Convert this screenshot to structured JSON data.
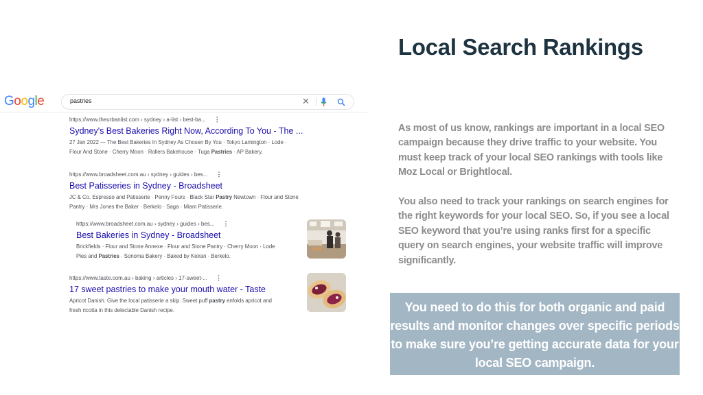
{
  "title": "Local Search Rankings",
  "serp": {
    "logo": {
      "letters": [
        {
          "char": "G",
          "color": "#4285F4"
        },
        {
          "char": "o",
          "color": "#EA4335"
        },
        {
          "char": "o",
          "color": "#FBBC05"
        },
        {
          "char": "g",
          "color": "#4285F4"
        },
        {
          "char": "l",
          "color": "#34A853"
        },
        {
          "char": "e",
          "color": "#EA4335"
        }
      ]
    },
    "query": "pastries",
    "clear_icon": "close-icon",
    "mic_icon": "mic-icon",
    "search_icon": "search-icon",
    "results": [
      {
        "url": "https://www.theurbanlist.com › sydney › a-list › best-ba...",
        "title": "Sydney's Best Bakeries Right Now, According To You - The ...",
        "snippet_line1": "27 Jan 2022 — The Best Bakeries In Sydney As Chosen By You · Tokyo Lamington · Lode ·",
        "snippet_line2_pre": "Flour And Stone · Cherry Moon · Rollers Bakehouse · Tuga ",
        "snippet_line2_bold": "Pastries",
        "snippet_line2_post": " · AP Bakery."
      },
      {
        "url": "https://www.broadsheet.com.au › sydney › guides › bes...",
        "title": "Best Patisseries in Sydney - Broadsheet",
        "snippet_line1_pre": "JC & Co. Espresso and Patisserie · Penny Fours · Black Star ",
        "snippet_line1_bold": "Pastry",
        "snippet_line1_post": " Newtown · Flour and Stone",
        "snippet_line2": "Pantry · Mrs Jones the Baker · Berkelo · Saga · Miam Patisserie."
      },
      {
        "url": "https://www.broadsheet.com.au › sydney › guides › bes...",
        "title": "Best Bakeries in Sydney - Broadsheet",
        "snippet_line1": "Brickfields · Flour and Stone Annexe · Flour and Stone Pantry · Cherry Moon · Lode",
        "snippet_line2_pre": "Pies and ",
        "snippet_line2_bold": "Pastries",
        "snippet_line2_post": " · Sonoma Bakery · Baked by Keiran · Berkelo."
      },
      {
        "url": "https://www.taste.com.au › baking › articles › 17-sweet-...",
        "title": "17 sweet pastries to make your mouth water - Taste",
        "snippet_line1_pre": "Apricot Danish. Give the local patisserie a skip. Sweet puff ",
        "snippet_line1_bold": "pastry",
        "snippet_line1_post": " enfolds apricot and",
        "snippet_line2": "fresh ricotta in this delectable Danish recipe."
      }
    ]
  },
  "paragraphs": [
    "As most of us know, rankings are important in a local SEO campaign because they drive traffic to your website. You must keep track of your local SEO rankings with tools like Moz Local or Brightlocal.",
    "You also need to track your rankings on search engines for the right keywords for your local SEO. So, if you see a local SEO keyword that you’re using ranks first for a specific query on search engines, your website traffic will improve significantly."
  ],
  "callout": "You need to do this for both organic and paid results and monitor changes over specific periods to make sure you’re getting accurate data for your local SEO campaign.",
  "colors": {
    "title": "#1d3340",
    "body_text": "#8c8c8c",
    "callout_bg": "#a3b6c4",
    "link": "#1a0dab"
  }
}
